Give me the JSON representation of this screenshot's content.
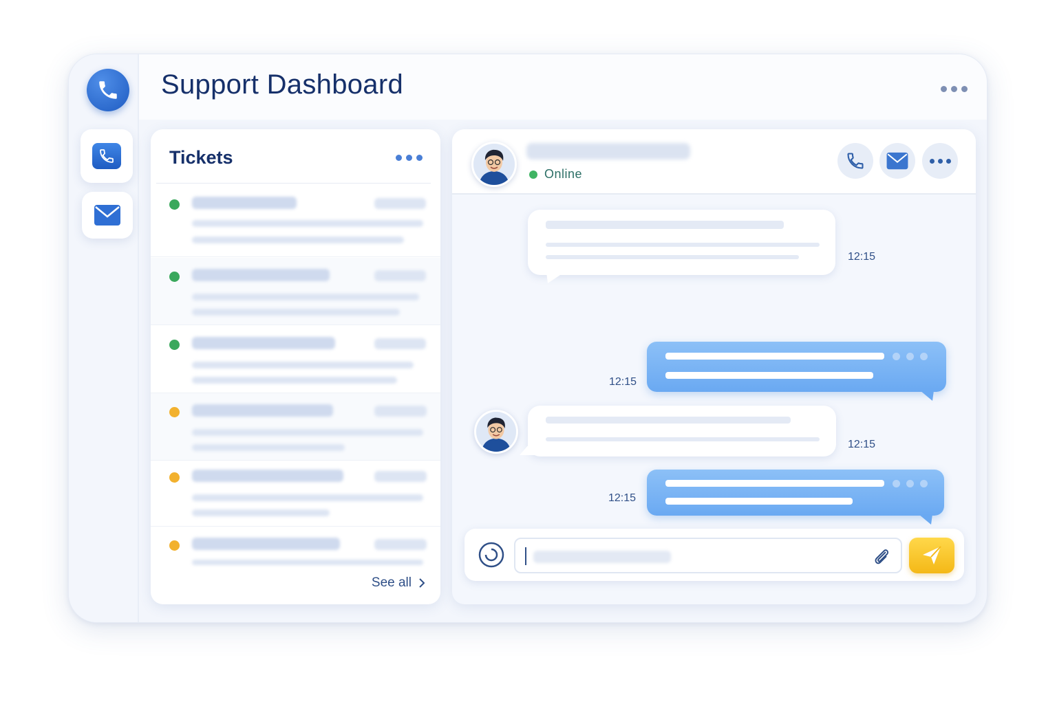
{
  "header": {
    "title": "Support Dashboard"
  },
  "rail": {
    "logo_icon": "phone-icon",
    "items": [
      {
        "name": "phone",
        "icon": "phone-icon"
      },
      {
        "name": "mail",
        "icon": "mail-icon"
      }
    ]
  },
  "tickets": {
    "title": "Tickets",
    "statuses": [
      "green",
      "green",
      "green",
      "orange",
      "orange",
      "orange"
    ],
    "see_all": "See all"
  },
  "chat": {
    "contact_status": "Online",
    "actions": [
      "phone-icon",
      "mail-icon",
      "more-icon"
    ],
    "messages": [
      {
        "direction": "incoming",
        "time": "12:15"
      },
      {
        "direction": "outgoing",
        "time": "12:15"
      },
      {
        "direction": "incoming",
        "time": "12:15"
      },
      {
        "direction": "outgoing",
        "time": "12:15"
      }
    ]
  },
  "composer": {
    "emoji_icon": "emoji-icon",
    "attach_icon": "paperclip-icon",
    "send_icon": "send-icon"
  },
  "colors": {
    "accent_blue": "#1f5cc2",
    "outgoing_bubble": "#6aa9f2",
    "status_green": "#3aa85c",
    "status_orange": "#f2b12e",
    "send_yellow": "#f4b817",
    "title_navy": "#16306a"
  }
}
